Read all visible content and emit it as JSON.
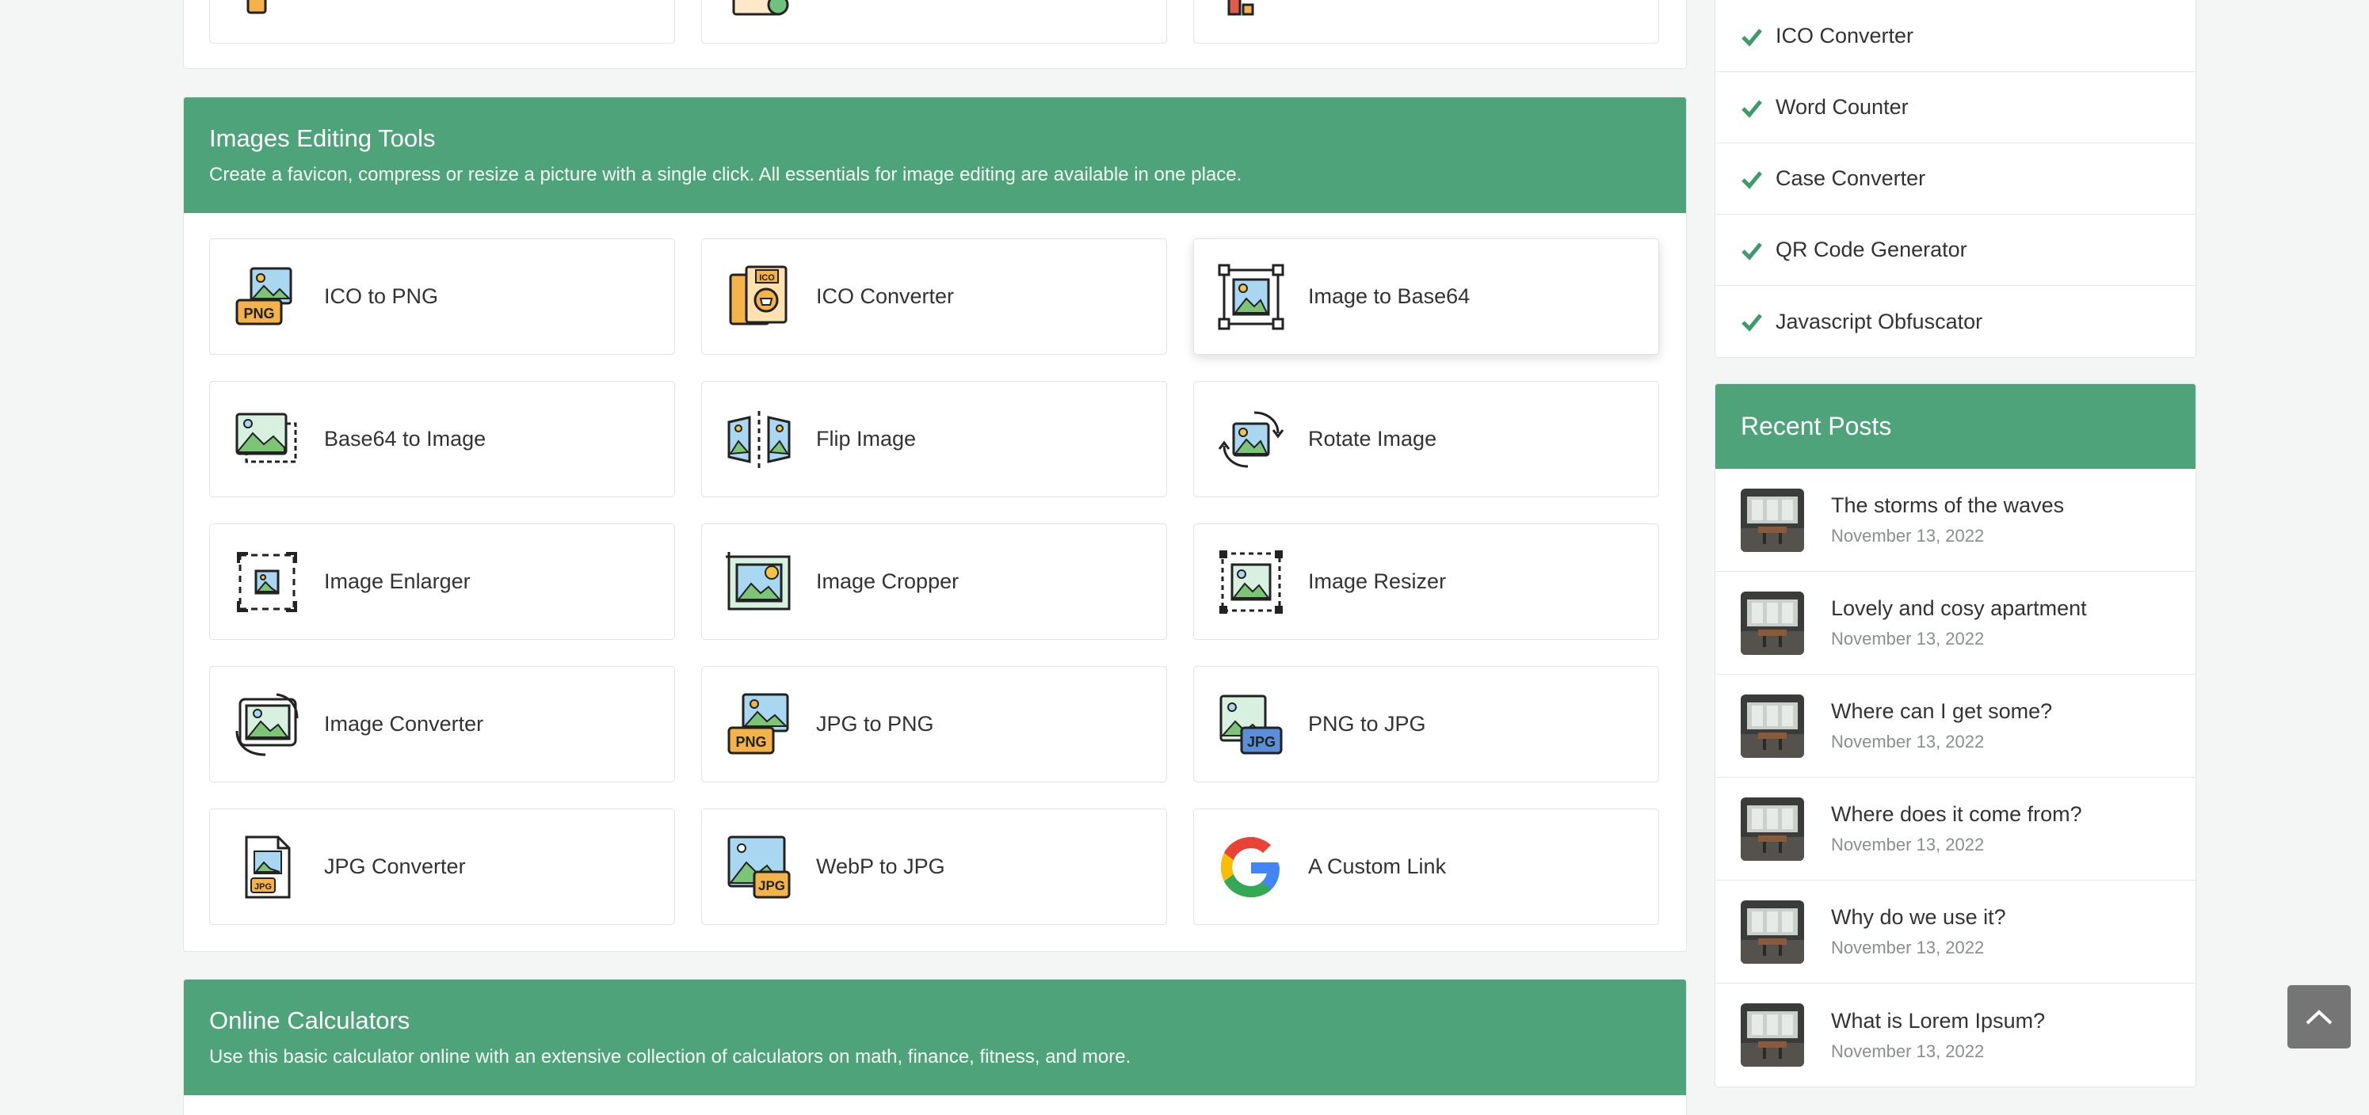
{
  "images_section": {
    "title": "Images Editing Tools",
    "description": "Create a favicon, compress or resize a picture with a single click. All essentials for image editing are available in one place.",
    "tools": [
      {
        "label": "ICO to PNG",
        "icon": "ico-to-png-icon"
      },
      {
        "label": "ICO Converter",
        "icon": "ico-converter-icon"
      },
      {
        "label": "Image to Base64",
        "icon": "image-to-base64-icon"
      },
      {
        "label": "Base64 to Image",
        "icon": "base64-to-image-icon"
      },
      {
        "label": "Flip Image",
        "icon": "flip-image-icon"
      },
      {
        "label": "Rotate Image",
        "icon": "rotate-image-icon"
      },
      {
        "label": "Image Enlarger",
        "icon": "image-enlarger-icon"
      },
      {
        "label": "Image Cropper",
        "icon": "image-cropper-icon"
      },
      {
        "label": "Image Resizer",
        "icon": "image-resizer-icon"
      },
      {
        "label": "Image Converter",
        "icon": "image-converter-icon"
      },
      {
        "label": "JPG to PNG",
        "icon": "jpg-to-png-icon"
      },
      {
        "label": "PNG to JPG",
        "icon": "png-to-jpg-icon"
      },
      {
        "label": "JPG Converter",
        "icon": "jpg-converter-icon"
      },
      {
        "label": "WebP to JPG",
        "icon": "webp-to-jpg-icon"
      },
      {
        "label": "A Custom Link",
        "icon": "google-icon"
      }
    ],
    "icon_badges": {
      "png": "PNG",
      "ico": "ICO",
      "jpg": "JPG"
    }
  },
  "calculators_section": {
    "title": "Online Calculators",
    "description": "Use this basic calculator online with an extensive collection of calculators on math, finance, fitness, and more."
  },
  "sidebar": {
    "links": [
      {
        "label": "ICO Converter"
      },
      {
        "label": "Word Counter"
      },
      {
        "label": "Case Converter"
      },
      {
        "label": "QR Code Generator"
      },
      {
        "label": "Javascript Obfuscator"
      }
    ],
    "recent_posts": {
      "title": "Recent Posts",
      "posts": [
        {
          "title": "The storms of the waves",
          "date": "November 13, 2022"
        },
        {
          "title": "Lovely and cosy apartment",
          "date": "November 13, 2022"
        },
        {
          "title": "Where can I get some?",
          "date": "November 13, 2022"
        },
        {
          "title": "Where does it come from?",
          "date": "November 13, 2022"
        },
        {
          "title": "Why do we use it?",
          "date": "November 13, 2022"
        },
        {
          "title": "What is Lorem Ipsum?",
          "date": "November 13, 2022"
        }
      ]
    }
  },
  "colors": {
    "accent": "#4fa37a",
    "check": "#3d9a6a",
    "scroll_button": "#757575"
  }
}
